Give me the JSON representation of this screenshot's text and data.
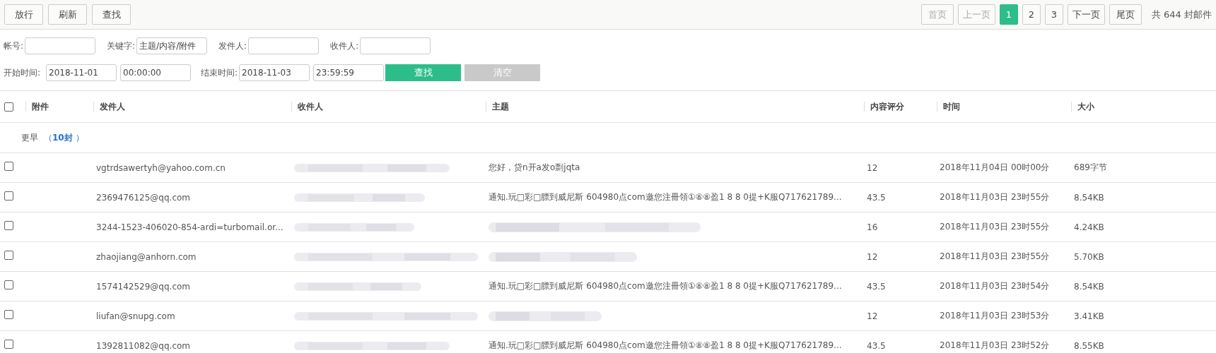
{
  "toolbar": {
    "buttons": [
      "放行",
      "刷新",
      "查找"
    ]
  },
  "pager": {
    "first": {
      "label": "首页",
      "disabled": true
    },
    "prev": {
      "label": "上一页",
      "disabled": true
    },
    "pages": [
      {
        "label": "1",
        "selected": true
      },
      {
        "label": "2",
        "selected": false
      },
      {
        "label": "3",
        "selected": false
      }
    ],
    "next": {
      "label": "下一页",
      "disabled": false
    },
    "last": {
      "label": "尾页",
      "disabled": false
    },
    "total": "共 644 封邮件"
  },
  "filters": {
    "account": {
      "label": "帐号:"
    },
    "keyword": {
      "label": "关键字:",
      "value": "主题/内容/附件"
    },
    "sender": {
      "label": "发件人:"
    },
    "recipient": {
      "label": "收件人:"
    },
    "start": {
      "label": "开始时间:",
      "date": "2018-11-01",
      "time": "00:00:00"
    },
    "end": {
      "label": "结束时间:",
      "date": "2018-11-03",
      "time": "23:59:59"
    },
    "search_button": "查找",
    "clear_button": "清空"
  },
  "table": {
    "select_all_checked": false,
    "columns": [
      "附件",
      "发件人",
      "收件人",
      "主题",
      "内容评分",
      "时间",
      "大小"
    ],
    "group": {
      "label": "更早",
      "count": "（**10封** ）"
    },
    "rows": [
      {
        "checked": false,
        "sender": "vgtrdsawertyh@yahoo.com.cn",
        "subject": "您好，贷n开a发o剽jqta",
        "score": "12",
        "time": "2018年11月04日 00时00分",
        "size": "689字节"
      },
      {
        "checked": false,
        "sender": "2369476125@qq.com",
        "subject": "通知.玩□彩□膘到威尼斯 604980点com邀您注冊領①⑧⑧盈1 8 8 0提+K服Q717621789...",
        "score": "43.5",
        "time": "2018年11月03日 23时55分",
        "size": "8.54KB"
      },
      {
        "checked": false,
        "sender": "3244-1523-406020-854-ardi=turbomail.or...",
        "score": "16",
        "time": "2018年11月03日 23时55分",
        "size": "4.24KB"
      },
      {
        "checked": false,
        "sender": "zhaojiang@anhorn.com",
        "score": "12",
        "time": "2018年11月03日 23时55分",
        "size": "5.70KB"
      },
      {
        "checked": false,
        "sender": "1574142529@qq.com",
        "subject": "通知.玩□彩□膘到威尼斯 604980点com邀您注冊領①⑧⑧盈1 8 8 0提+K服Q717621789...",
        "score": "43.5",
        "time": "2018年11月03日 23时54分",
        "size": "8.54KB"
      },
      {
        "checked": false,
        "sender": "liufan@snupg.com",
        "score": "12",
        "time": "2018年11月03日 23时53分",
        "size": "3.41KB"
      },
      {
        "checked": false,
        "sender": "1392811082@qq.com",
        "subject": "通知.玩□彩□膘到威尼斯 604980点com邀您注冊領①⑧⑧盈1 8 8 0提+K服Q717621789...",
        "score": "43.5",
        "time": "2018年11月03日 23时52分",
        "size": "8.55KB"
      }
    ]
  }
}
